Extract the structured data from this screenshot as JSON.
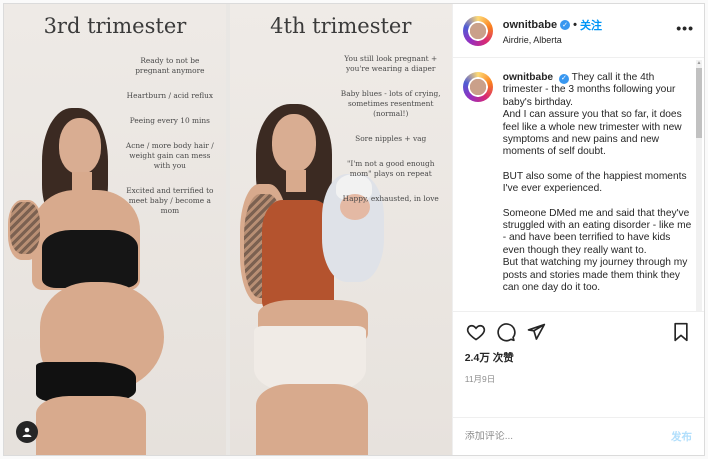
{
  "media": {
    "left_panel": {
      "title": "3rd trimester",
      "notes": [
        "Ready to not be pregnant anymore",
        "Heartburn / acid reflux",
        "Peeing every 10 mins",
        "Acne / more body hair / weight gain can mess with you",
        "Excited and terrified to meet baby / become a mom"
      ]
    },
    "right_panel": {
      "title": "4th trimester",
      "notes": [
        "You still look pregnant + you're wearing a diaper",
        "Baby blues - lots of crying, sometimes resentment (normal!)",
        "Sore nipples + vag",
        "\"I'm not a good enough mom\" plays on repeat",
        "Happy, exhausted, in love"
      ]
    }
  },
  "header": {
    "username": "ownitbabe",
    "follow_label": "关注",
    "separator": "•",
    "location": "Airdrie, Alberta",
    "more_label": "•••"
  },
  "caption": {
    "username": "ownitbabe",
    "paragraphs": [
      "They call it the 4th trimester - the 3 months following your baby's birthday.\nAnd I can assure you that so far, it does feel like a whole new trimester with new symptoms and new pains and new moments of self doubt.",
      "BUT also some of the happiest moments I've ever experienced.",
      "Someone DMed me and said that they've struggled with an eating disorder - like me - and have been terrified to have kids even though they really want to.\nBut that watching my journey through my posts and stories made them think they can one day do it too."
    ]
  },
  "actions": {
    "likes": "2.4万 次赞",
    "date": "11月9日"
  },
  "comment": {
    "placeholder": "添加评论...",
    "post_label": "发布"
  },
  "colors": {
    "accent": "#0095f6",
    "verified": "#3897f0",
    "post_disabled": "#b2dffc"
  }
}
